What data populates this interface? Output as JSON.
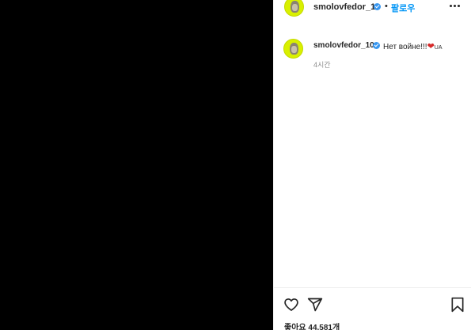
{
  "post": {
    "username": "smolovfedor_10",
    "separator": "•",
    "follow_label": "팔로우",
    "more_icon": "more-horizontal-icon",
    "verified_icon": "verified-badge-icon"
  },
  "caption": {
    "username": "smolovfedor_10",
    "text": "Нет войне!!!",
    "heart": "❤",
    "flag": "UA",
    "time": "4시간"
  },
  "actions": {
    "like_icon": "heart-icon",
    "share_icon": "share-icon",
    "save_icon": "bookmark-icon",
    "likes_text": "좋아요 44,581개"
  },
  "colors": {
    "accent": "#0095f6",
    "verified": "#3897f0",
    "media_bg": "#000000",
    "avatar_bg": "#d9f000"
  }
}
